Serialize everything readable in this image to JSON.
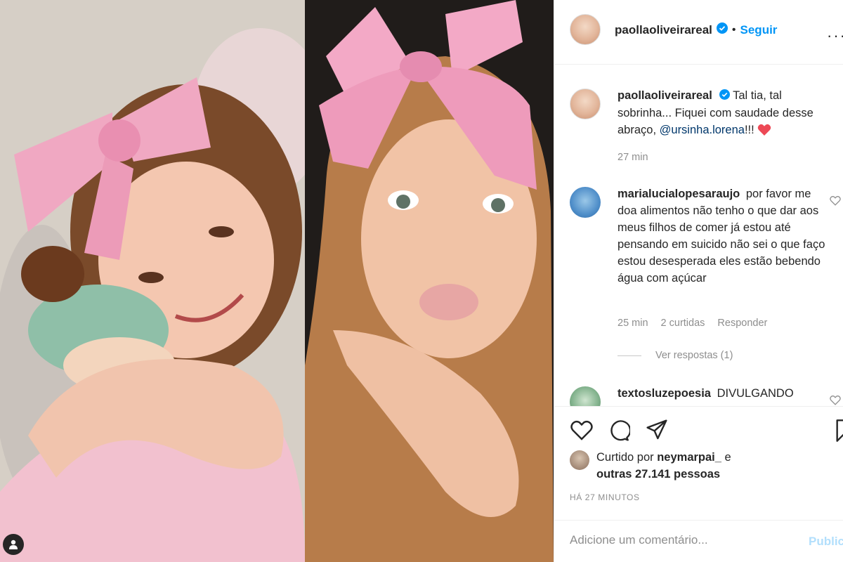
{
  "post": {
    "author": "paollaoliveirareal",
    "separator": "•",
    "follow_label": "Seguir",
    "more_label": "···"
  },
  "caption": {
    "username": "paollaoliveirareal",
    "text_before": "Tal tia, tal sobrinha... Fiquei com saudade desse abraço,",
    "mention": "@ursinha.lorena",
    "text_after": "!!!",
    "time": "27 min"
  },
  "comments": [
    {
      "username": "marialucialopesaraujo",
      "text": "por favor me doa alimentos não tenho o que dar aos meus filhos de comer já estou até pensando em suicido não sei o que faço estou desesperada eles estão bebendo água com açúcar",
      "time": "25 min",
      "likes": "2 curtidas",
      "reply_label": "Responder",
      "view_replies": "Ver respostas (1)"
    },
    {
      "username": "textosluzepoesia",
      "text": "DIVULGANDO"
    }
  ],
  "likes": {
    "prefix": "Curtido por",
    "user": "neymarpai_",
    "connector": "e",
    "others": "outras 27.141 pessoas"
  },
  "timestamp": "HÁ 27 MINUTOS",
  "add_comment": {
    "placeholder": "Adicione um comentário...",
    "publish_label": "Publicar"
  },
  "colors": {
    "link_blue": "#0095f6",
    "mention_blue": "#00376b",
    "heart_red": "#ed4956",
    "muted_text": "#8e8e8e",
    "disabled_publish": "#b2dffc"
  }
}
